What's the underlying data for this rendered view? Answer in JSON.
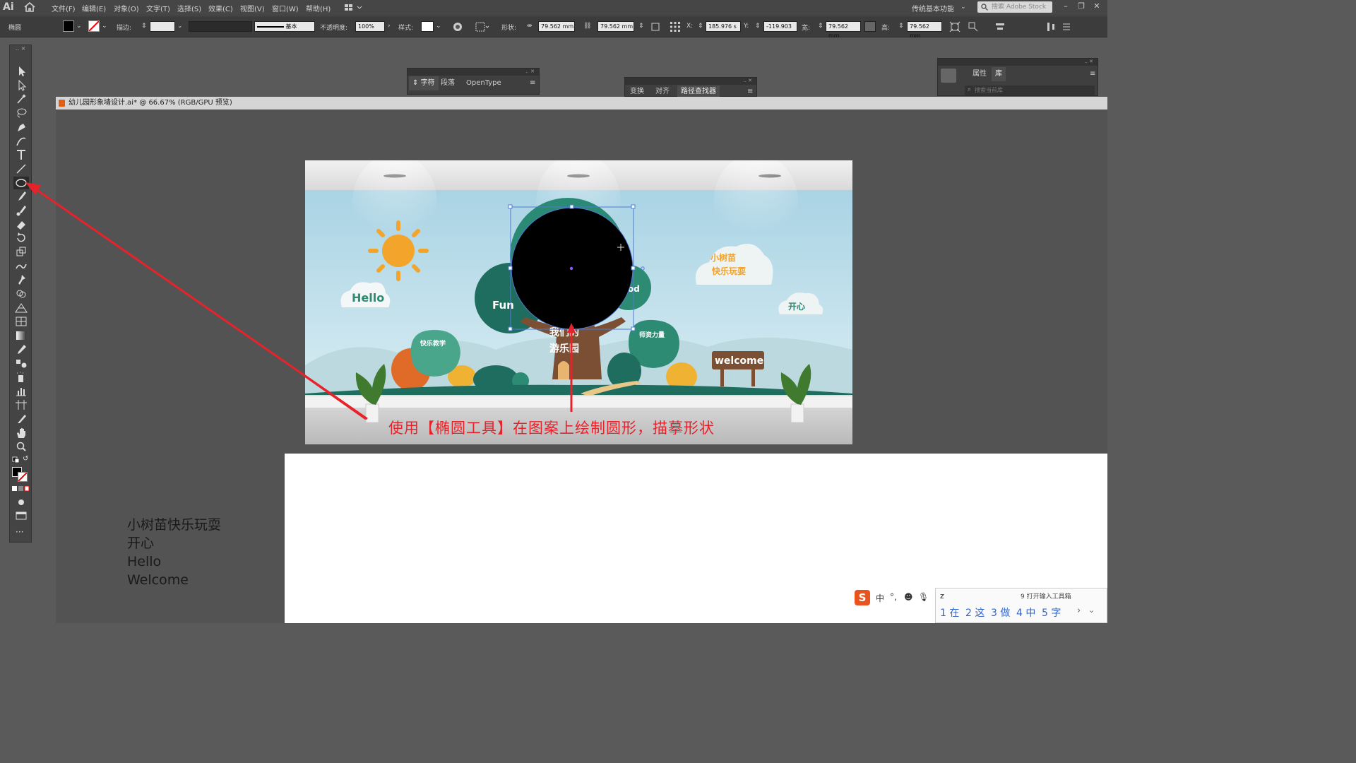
{
  "app": {
    "logo": "Ai",
    "workspace": "传统基本功能",
    "search_placeholder": "搜索 Adobe Stock",
    "menu": [
      "文件(F)",
      "编辑(E)",
      "对象(O)",
      "文字(T)",
      "选择(S)",
      "效果(C)",
      "视图(V)",
      "窗口(W)",
      "帮助(H)"
    ]
  },
  "controlbar": {
    "selection_label": "椭圆",
    "stroke_label": "描边:",
    "stroke_style": "基本",
    "opacity_label": "不透明度:",
    "opacity_value": "100%",
    "style_label": "样式:",
    "shape_label": "形状:",
    "shape_w": "79.562 mm",
    "shape_h": "79.562 mm",
    "x_label": "X:",
    "x_value": "185.976 s",
    "y_label": "Y:",
    "y_value": "-119.903",
    "w_label": "宽:",
    "w_value": "79.562 mm",
    "h_label": "高:",
    "h_value": "79.562 mm"
  },
  "panels": {
    "char": {
      "tabs": [
        "字符",
        "段落",
        "OpenType"
      ]
    },
    "align": {
      "tabs": [
        "变换",
        "对齐",
        "路径查找器"
      ]
    },
    "props": {
      "tabs": [
        "属性",
        "库"
      ],
      "search_placeholder": "搜索当前库"
    }
  },
  "document": {
    "tab_title": "幼儿园形象墙设计.ai* @ 66.67% (RGB/GPU 预览)"
  },
  "artwork": {
    "hello": "Hello",
    "fun": "Fun",
    "od": "od",
    "cloud_text_1": "小树苗",
    "cloud_text_2": "快乐玩耍",
    "happy": "开心",
    "tree_title_1": "我们的",
    "tree_title_2": "游乐园",
    "left_bush": "快乐教学",
    "right_bush": "师资力量",
    "sign": "welcome"
  },
  "caption": "使用【椭圆工具】在图案上绘制圆形，描摹形状",
  "textblock": [
    "小树苗快乐玩耍",
    "开心",
    "Hello",
    "Welcome"
  ],
  "ime": {
    "logo": "S",
    "mode": "中",
    "input": "z",
    "hint": "9 打开输入工具箱",
    "candidates": [
      "1 在",
      "2 这",
      "3 做",
      "4 中",
      "5 字"
    ]
  }
}
